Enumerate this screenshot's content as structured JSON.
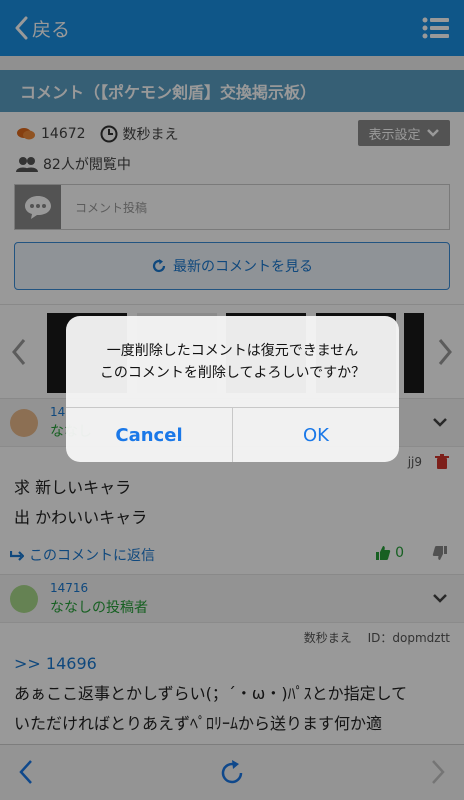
{
  "topbar": {
    "back_label": "戻る"
  },
  "title": "コメント（【ポケモン剣盾】交換掲示板）",
  "stats": {
    "comment_count": "14672",
    "updated": "数秒まえ",
    "viewers": "82人が閲覧中"
  },
  "display_settings_label": "表示設定",
  "post_input": {
    "placeholder": "コメント投稿"
  },
  "latest_button_label": "最新のコメントを見る",
  "comments": [
    {
      "number": "14",
      "author": "ななし",
      "id_fragment": "jj9",
      "lines": [
        "求 新しいキャラ",
        "出 かわいいキャラ"
      ],
      "reply_label": "このコメントに返信",
      "good_count": "0"
    },
    {
      "number": "14716",
      "author": "ななしの投稿者",
      "time": "数秒まえ",
      "id_label": "ID：dopmdztt",
      "anchor": ">> 14696",
      "lines": [
        "あぁここ返事とかしずらい(；´・ω・)ﾊﾟｽとか指定して",
        "いただければとりあえずﾍﾟﾛﾘｰﾑから送ります何か適"
      ]
    }
  ],
  "dialog": {
    "line1": "一度削除したコメントは復元できません",
    "line2": "このコメントを削除してよろしいですか？",
    "cancel_label": "Cancel",
    "ok_label": "OK"
  },
  "colors": {
    "topbar": "#1a8fe3",
    "titlebar": "#5a9ec4",
    "link": "#1a78d0",
    "author": "#27a13a"
  }
}
